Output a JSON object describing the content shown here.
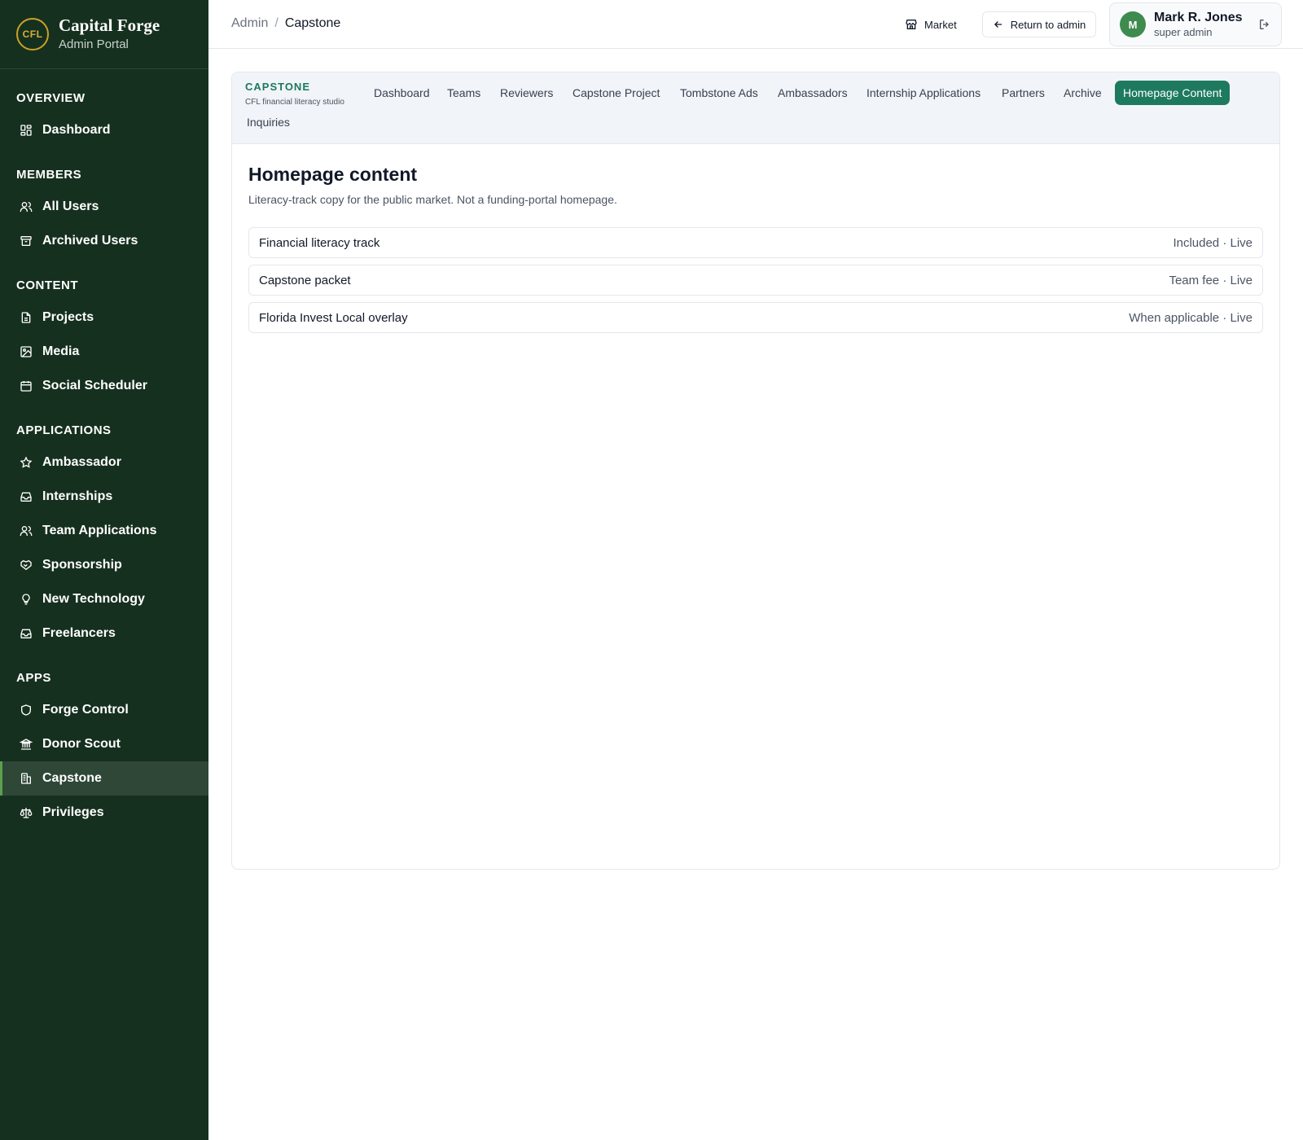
{
  "brand": {
    "logo_text": "CFL",
    "title": "Capital Forge",
    "subtitle": "Admin Portal"
  },
  "sidebar": {
    "sections": [
      {
        "header": "OVERVIEW",
        "items": [
          {
            "label": "Dashboard",
            "icon": "dashboard-icon"
          }
        ]
      },
      {
        "header": "MEMBERS",
        "items": [
          {
            "label": "All Users",
            "icon": "users-icon"
          },
          {
            "label": "Archived Users",
            "icon": "archive-icon"
          }
        ]
      },
      {
        "header": "CONTENT",
        "items": [
          {
            "label": "Projects",
            "icon": "document-icon"
          },
          {
            "label": "Media",
            "icon": "image-icon"
          },
          {
            "label": "Social Scheduler",
            "icon": "calendar-icon"
          }
        ]
      },
      {
        "header": "APPLICATIONS",
        "items": [
          {
            "label": "Ambassador",
            "icon": "star-icon"
          },
          {
            "label": "Internships",
            "icon": "inbox-icon"
          },
          {
            "label": "Team Applications",
            "icon": "users-icon"
          },
          {
            "label": "Sponsorship",
            "icon": "handshake-icon"
          },
          {
            "label": "New Technology",
            "icon": "lightbulb-icon"
          },
          {
            "label": "Freelancers",
            "icon": "inbox-icon"
          }
        ]
      },
      {
        "header": "APPS",
        "items": [
          {
            "label": "Forge Control",
            "icon": "shield-icon"
          },
          {
            "label": "Donor Scout",
            "icon": "bank-icon"
          },
          {
            "label": "Capstone",
            "icon": "building-icon",
            "active": true
          },
          {
            "label": "Privileges",
            "icon": "scale-icon"
          }
        ]
      }
    ]
  },
  "topbar": {
    "breadcrumb_root": "Admin",
    "breadcrumb_sep": "/",
    "breadcrumb_current": "Capstone",
    "market_label": "Market",
    "return_label": "Return to admin",
    "user": {
      "initial": "M",
      "name": "Mark R. Jones",
      "role": "super admin"
    }
  },
  "subnav": {
    "title": "CAPSTONE",
    "subtitle": "CFL financial literacy studio",
    "tabs": [
      {
        "label": "Dashboard"
      },
      {
        "label": "Teams"
      },
      {
        "label": "Reviewers"
      },
      {
        "label": "Capstone Project"
      },
      {
        "label": "Tombstone Ads"
      },
      {
        "label": "Ambassadors"
      },
      {
        "label": "Internship Applications"
      },
      {
        "label": "Partners"
      },
      {
        "label": "Archive"
      },
      {
        "label": "Homepage Content",
        "active": true
      },
      {
        "label": "Inquiries"
      }
    ]
  },
  "main": {
    "title": "Homepage content",
    "description": "Literacy-track copy for the public market. Not a funding-portal homepage.",
    "rows": [
      {
        "name": "Financial literacy track",
        "status": "Included · Live"
      },
      {
        "name": "Capstone packet",
        "status": "Team fee · Live"
      },
      {
        "name": "Florida Invest Local overlay",
        "status": "When applicable · Live"
      }
    ]
  },
  "colors": {
    "sidebar_bg": "#16301f",
    "active_nav_bg": "#2e4737",
    "active_accent": "#5aa04d",
    "tab_active_bg": "#1e7a5e",
    "subnav_title": "#1a7a5c",
    "avatar_bg": "#3f8a4f",
    "logo_gold": "#d4af37"
  }
}
